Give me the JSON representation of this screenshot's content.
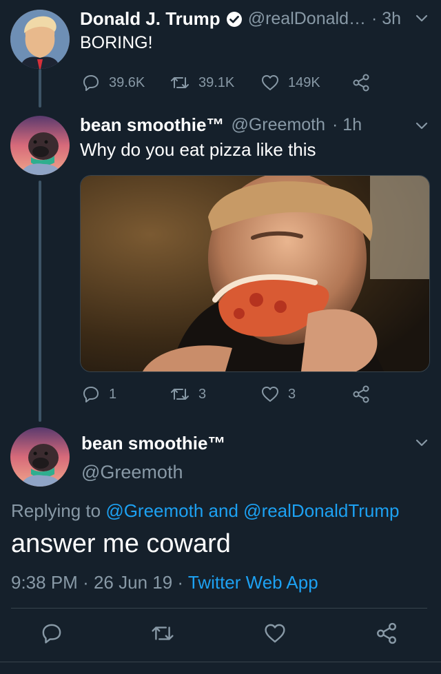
{
  "tweet1": {
    "name": "Donald J. Trump",
    "handle": "@realDonald…",
    "time": "· 3h",
    "text": "BORING!",
    "replies": "39.6K",
    "retweets": "39.1K",
    "likes": "149K"
  },
  "tweet2": {
    "name": "bean smoothie™",
    "handle": "@Greemoth",
    "time": "· 1h",
    "text": "Why do you eat pizza like this",
    "replies": "1",
    "retweets": "3",
    "likes": "3"
  },
  "main": {
    "name": "bean smoothie™",
    "handle": "@Greemoth",
    "replying_prefix": "Replying to",
    "reply_user1": "@Greemoth",
    "reply_and": "and",
    "reply_user2": "@realDonaldTrump",
    "text": "answer me coward",
    "time": "9:38 PM",
    "date": "26 Jun 19",
    "source": "Twitter Web App"
  },
  "icons": {
    "verified": "verified-badge-icon",
    "chevron": "chevron-down-icon",
    "reply": "reply-icon",
    "retweet": "retweet-icon",
    "like": "heart-icon",
    "share": "share-icon"
  },
  "colors": {
    "background": "#15202b",
    "muted": "#8899a6",
    "link": "#1da1f2",
    "divider": "#38444d"
  }
}
